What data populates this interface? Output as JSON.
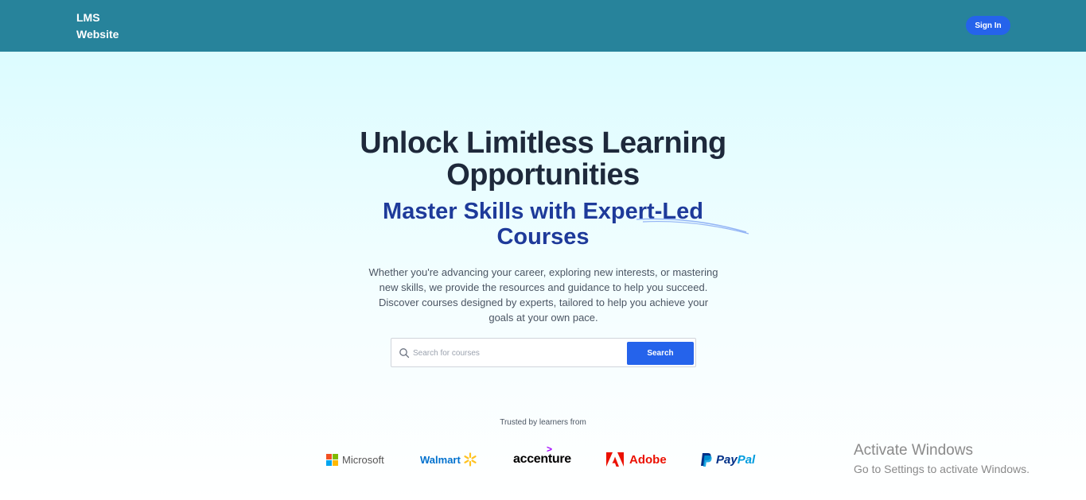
{
  "header": {
    "logo_line1": "LMS",
    "logo_line2": "Website",
    "signin_label": "Sign In",
    "bg_color": "#27839b"
  },
  "hero": {
    "title_line1": "Unlock Limitless Learning",
    "title_line2": "Opportunities",
    "subtitle_line1": "Master Skills with Expert-Led",
    "subtitle_line2": "Courses",
    "description": "Whether you're advancing your career, exploring new interests, or mastering new skills, we provide the resources and guidance to help you succeed. Discover courses designed by experts, tailored to help you achieve your goals at your own pace."
  },
  "search": {
    "placeholder": "Search for courses",
    "value": "",
    "button_label": "Search",
    "icon": "search-icon"
  },
  "trusted": {
    "label": "Trusted by learners from",
    "brands": [
      {
        "name": "Microsoft",
        "icon": "microsoft-logo"
      },
      {
        "name": "Walmart",
        "icon": "walmart-spark-logo"
      },
      {
        "name": "accenture",
        "icon": "accenture-chevron-logo"
      },
      {
        "name": "Adobe",
        "icon": "adobe-logo"
      },
      {
        "name": "PayPal",
        "name_part1": "Pay",
        "name_part2": "Pal",
        "icon": "paypal-logo"
      }
    ]
  },
  "watermark": {
    "line1": "Activate Windows",
    "line2": "Go to Settings to activate Windows."
  },
  "colors": {
    "accent": "#2563eb",
    "title": "#1e293b",
    "subtitle": "#1e3a9a"
  }
}
